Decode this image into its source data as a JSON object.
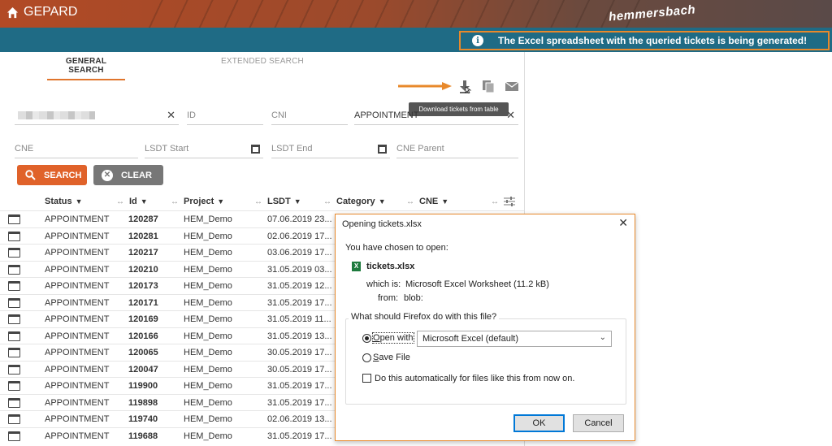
{
  "header": {
    "app_name": "GEPARD",
    "logo_text": "hemmersbach",
    "notice": "The Excel spreadsheet with the queried tickets is being generated!"
  },
  "tabs": [
    {
      "label": "GENERAL SEARCH",
      "active": true
    },
    {
      "label": "EXTENDED SEARCH",
      "active": false
    }
  ],
  "toolbar": {
    "download_tooltip": "Download tickets from table",
    "icons": [
      "download-icon",
      "copy-icon",
      "mail-icon"
    ]
  },
  "filters": {
    "status_value": "APPOINTMENT",
    "id_placeholder": "ID",
    "cni_placeholder": "CNI",
    "cne_placeholder": "CNE",
    "lsdt_start_placeholder": "LSDT Start",
    "lsdt_end_placeholder": "LSDT End",
    "cne_parent_placeholder": "CNE Parent"
  },
  "buttons": {
    "search": "SEARCH",
    "clear": "CLEAR"
  },
  "table": {
    "columns": [
      "Status",
      "Id",
      "Project",
      "LSDT",
      "Category",
      "CNE"
    ],
    "rows": [
      {
        "status": "APPOINTMENT",
        "id": "120287",
        "project": "HEM_Demo",
        "lsdt": "07.06.2019 23..."
      },
      {
        "status": "APPOINTMENT",
        "id": "120281",
        "project": "HEM_Demo",
        "lsdt": "02.06.2019 17..."
      },
      {
        "status": "APPOINTMENT",
        "id": "120217",
        "project": "HEM_Demo",
        "lsdt": "03.06.2019 17..."
      },
      {
        "status": "APPOINTMENT",
        "id": "120210",
        "project": "HEM_Demo",
        "lsdt": "31.05.2019 03..."
      },
      {
        "status": "APPOINTMENT",
        "id": "120173",
        "project": "HEM_Demo",
        "lsdt": "31.05.2019 12..."
      },
      {
        "status": "APPOINTMENT",
        "id": "120171",
        "project": "HEM_Demo",
        "lsdt": "31.05.2019 17..."
      },
      {
        "status": "APPOINTMENT",
        "id": "120169",
        "project": "HEM_Demo",
        "lsdt": "31.05.2019 11..."
      },
      {
        "status": "APPOINTMENT",
        "id": "120166",
        "project": "HEM_Demo",
        "lsdt": "31.05.2019 13..."
      },
      {
        "status": "APPOINTMENT",
        "id": "120065",
        "project": "HEM_Demo",
        "lsdt": "30.05.2019 17..."
      },
      {
        "status": "APPOINTMENT",
        "id": "120047",
        "project": "HEM_Demo",
        "lsdt": "30.05.2019 17..."
      },
      {
        "status": "APPOINTMENT",
        "id": "119900",
        "project": "HEM_Demo",
        "lsdt": "31.05.2019 17..."
      },
      {
        "status": "APPOINTMENT",
        "id": "119898",
        "project": "HEM_Demo",
        "lsdt": "31.05.2019 17..."
      },
      {
        "status": "APPOINTMENT",
        "id": "119740",
        "project": "HEM_Demo",
        "lsdt": "02.06.2019 13..."
      },
      {
        "status": "APPOINTMENT",
        "id": "119688",
        "project": "HEM_Demo",
        "lsdt": "31.05.2019 17..."
      }
    ]
  },
  "dialog": {
    "title": "Opening tickets.xlsx",
    "intro": "You have chosen to open:",
    "filename": "tickets.xlsx",
    "which_is_label": "which is:",
    "which_is_value": "Microsoft Excel Worksheet (11.2 kB)",
    "from_label": "from:",
    "from_value": "blob:",
    "question": "What should Firefox do with this file?",
    "open_with_label": "Open with",
    "open_with_value": "Microsoft Excel (default)",
    "save_file_label": "Save File",
    "auto_label": "Do this automatically for files like this from now on.",
    "ok": "OK",
    "cancel": "Cancel"
  },
  "colors": {
    "accent": "#e0622a",
    "bluebar": "#1f6b85",
    "highlight": "#e8892b"
  }
}
